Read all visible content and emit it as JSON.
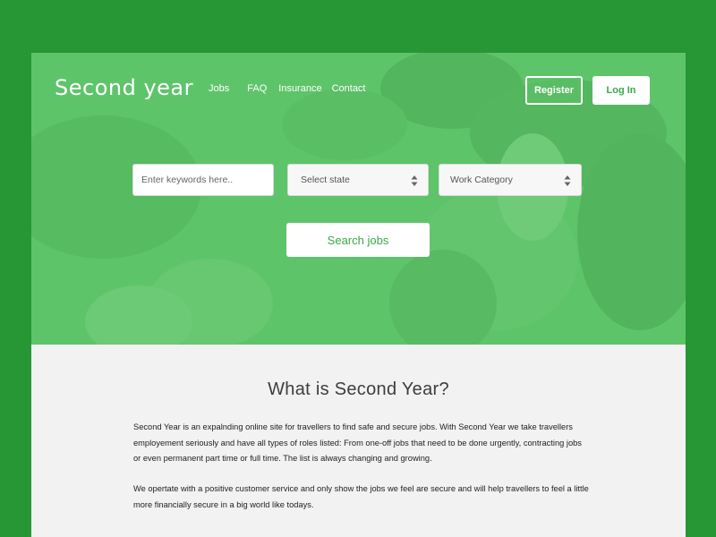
{
  "header": {
    "brand": "Second year",
    "nav": [
      "Jobs",
      "FAQ",
      "Insurance",
      "Contact"
    ],
    "register_label": "Register",
    "login_label": "Log In"
  },
  "search": {
    "keywords_placeholder": "Enter keywords here..",
    "state_select": "Select state",
    "category_select": "Work Category",
    "button_label": "Search jobs"
  },
  "about": {
    "title": "What is Second Year?",
    "paragraph1": "Second Year is an expalnding online site for travellers to find safe and secure jobs. With Second Year we take travellers employement seriously and have all types of roles listed: From one-off jobs that need to be done urgently, contracting jobs or even permanent part time or full time. The list is always changing and growing.",
    "paragraph2": "We opertate with a positive customer service and only show the jobs we feel are secure and will help travellers to feel a little more financially secure in a big world like todays."
  },
  "colors": {
    "frame": "#279635",
    "hero_overlay": "#5cc268",
    "accent": "#3aa94a"
  }
}
